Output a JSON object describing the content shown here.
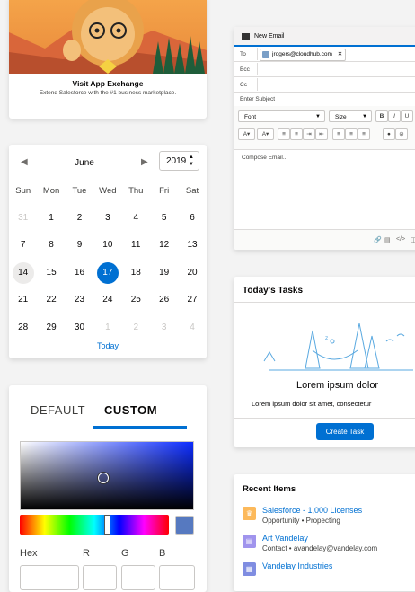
{
  "app_exchange": {
    "title": "Visit App Exchange",
    "subtitle": "Extend Salesforce with the #1 business marketplace."
  },
  "calendar": {
    "month": "June",
    "year": "2019",
    "prev_icon": "chevron-left-icon",
    "next_icon": "chevron-right-icon",
    "weekdays": [
      "Sun",
      "Mon",
      "Tue",
      "Wed",
      "Thu",
      "Fri",
      "Sat"
    ],
    "weeks": [
      [
        "31",
        "1",
        "2",
        "3",
        "4",
        "5",
        "6"
      ],
      [
        "7",
        "8",
        "9",
        "10",
        "11",
        "12",
        "13"
      ],
      [
        "14",
        "15",
        "16",
        "17",
        "18",
        "19",
        "20"
      ],
      [
        "21",
        "22",
        "23",
        "24",
        "25",
        "26",
        "27"
      ],
      [
        "28",
        "29",
        "30",
        "1",
        "2",
        "3",
        "4"
      ]
    ],
    "today_label": "Today"
  },
  "color_picker": {
    "tabs": [
      "DEFAULT",
      "CUSTOM"
    ],
    "active_tab": "CUSTOM",
    "accent": "#0070d2",
    "swatch_color": "#5679c0",
    "channels": {
      "hex_label": "Hex",
      "r_label": "R",
      "g_label": "G",
      "b_label": "B"
    }
  },
  "email": {
    "title": "New Email",
    "to_label": "To",
    "recipient": "jrogers@cloudhub.com",
    "bcc_label": "Bcc",
    "cc_label": "Cc",
    "subject_placeholder": "Enter Subject",
    "font_select": "Font",
    "size_select": "Size",
    "bold": "B",
    "italic": "I",
    "underline": "U",
    "body_placeholder": "Compose Email..."
  },
  "tasks": {
    "title": "Today's Tasks",
    "headline": "Lorem ipsum dolor",
    "body": "Lorem ipsum dolor sit amet, consectetur",
    "button": "Create Task"
  },
  "recent": {
    "title": "Recent Items",
    "items": [
      {
        "name": "Salesforce - 1,000 Licenses",
        "meta": "Opportunity • Propecting",
        "icon": "opportunity-icon",
        "color": "#fcb95b"
      },
      {
        "name": "Art Vandelay",
        "meta": "Contact • avandelay@vandelay.com",
        "icon": "contact-icon",
        "color": "#a094ed"
      },
      {
        "name": "Vandelay Industries",
        "meta": "",
        "icon": "account-icon",
        "color": "#7f8de1"
      }
    ]
  }
}
